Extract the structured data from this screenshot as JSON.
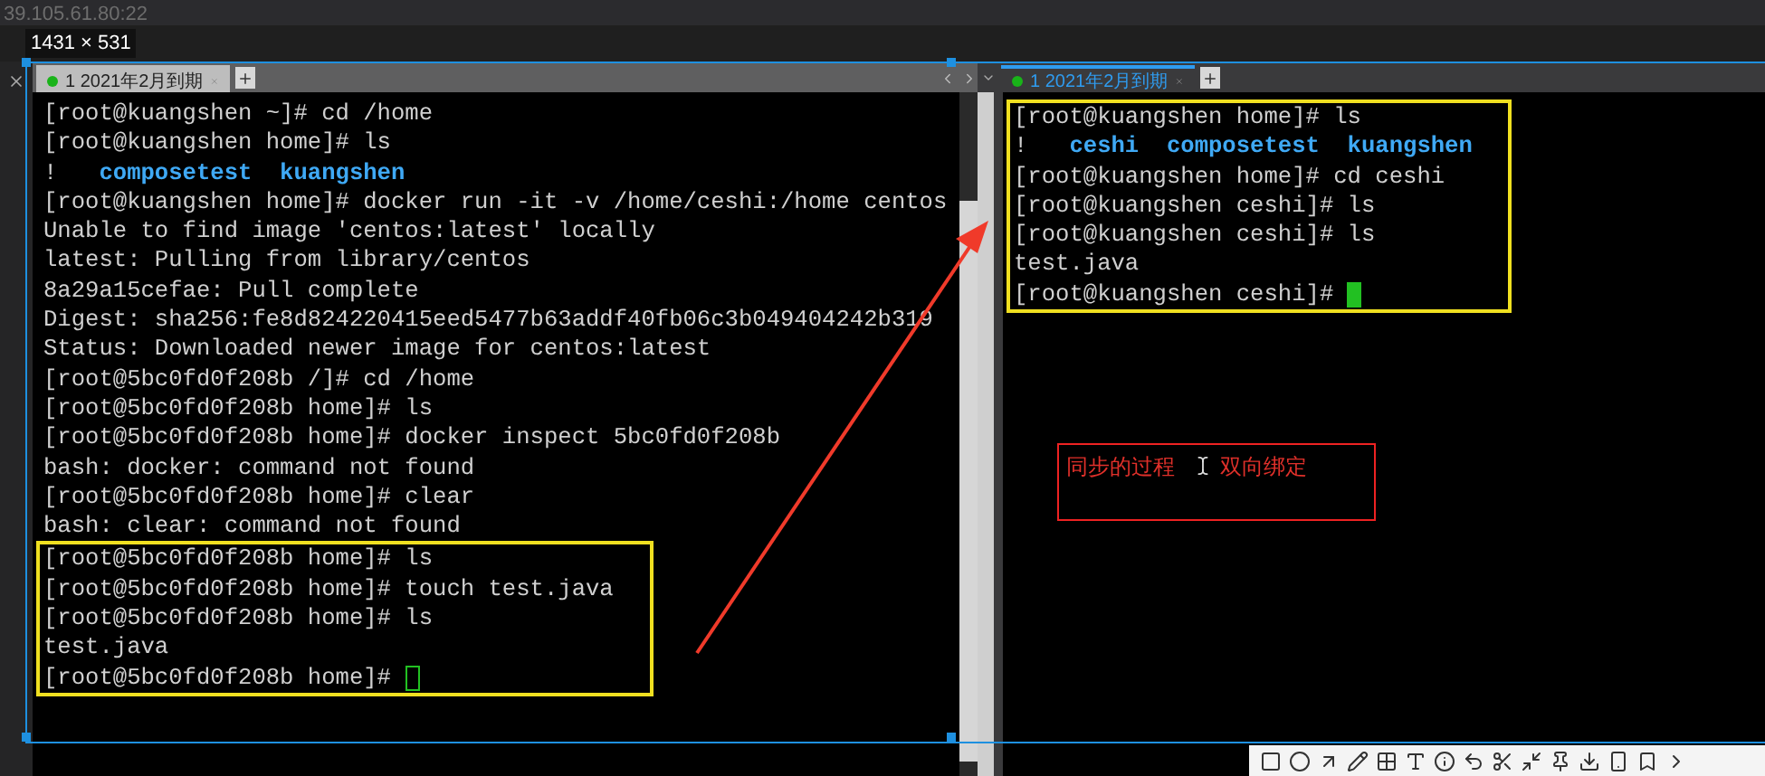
{
  "connection": {
    "host": "39.105.61.80:22"
  },
  "capture": {
    "dimensions": "1431 × 531"
  },
  "panes": [
    {
      "focused": false,
      "tab": {
        "label": "1 2021年2月到期",
        "selected": false
      },
      "blocks": [
        {
          "highlighted": false,
          "lines": [
            {
              "text": "[root@kuangshen ~]# cd /home"
            },
            {
              "text": "[root@kuangshen home]# ls"
            },
            {
              "text": "!",
              "entries": [
                "composetest",
                "kuangshen"
              ]
            },
            {
              "text": "[root@kuangshen home]# docker run -it -v /home/ceshi:/home centos"
            },
            {
              "text": "Unable to find image 'centos:latest' locally"
            },
            {
              "text": "latest: Pulling from library/centos"
            },
            {
              "text": "8a29a15cefae: Pull complete"
            },
            {
              "text": "Digest: sha256:fe8d824220415eed5477b63addf40fb06c3b049404242b319"
            },
            {
              "text": "Status: Downloaded newer image for centos:latest"
            },
            {
              "text": "[root@5bc0fd0f208b /]# cd /home"
            },
            {
              "text": "[root@5bc0fd0f208b home]# ls"
            },
            {
              "text": "[root@5bc0fd0f208b home]# docker inspect 5bc0fd0f208b"
            },
            {
              "text": "bash: docker: command not found"
            },
            {
              "text": "[root@5bc0fd0f208b home]# clear"
            },
            {
              "text": "bash: clear: command not found"
            }
          ],
          "cursor_at_end": false
        },
        {
          "highlighted": true,
          "lines": [
            {
              "text": "[root@5bc0fd0f208b home]# ls"
            },
            {
              "text": "[root@5bc0fd0f208b home]# touch test.java"
            },
            {
              "text": "[root@5bc0fd0f208b home]# ls"
            },
            {
              "text": "test.java"
            },
            {
              "text": "[root@5bc0fd0f208b home]#"
            }
          ],
          "cursor_at_end": true
        }
      ]
    },
    {
      "focused": true,
      "tab": {
        "label": "1 2021年2月到期",
        "selected": true
      },
      "blocks": [
        {
          "highlighted": true,
          "lines": [
            {
              "text": "[root@kuangshen home]# ls"
            },
            {
              "text": "!",
              "entries": [
                "ceshi",
                "composetest",
                "kuangshen"
              ]
            },
            {
              "text": "[root@kuangshen home]# cd ceshi"
            },
            {
              "text": "[root@kuangshen ceshi]# ls"
            },
            {
              "text": "[root@kuangshen ceshi]# ls"
            },
            {
              "text": "test.java"
            },
            {
              "text": "[root@kuangshen ceshi]#"
            }
          ],
          "cursor_at_end": true
        }
      ]
    }
  ],
  "annotation": {
    "texts": [
      "同步的过程",
      "双向绑定"
    ]
  }
}
